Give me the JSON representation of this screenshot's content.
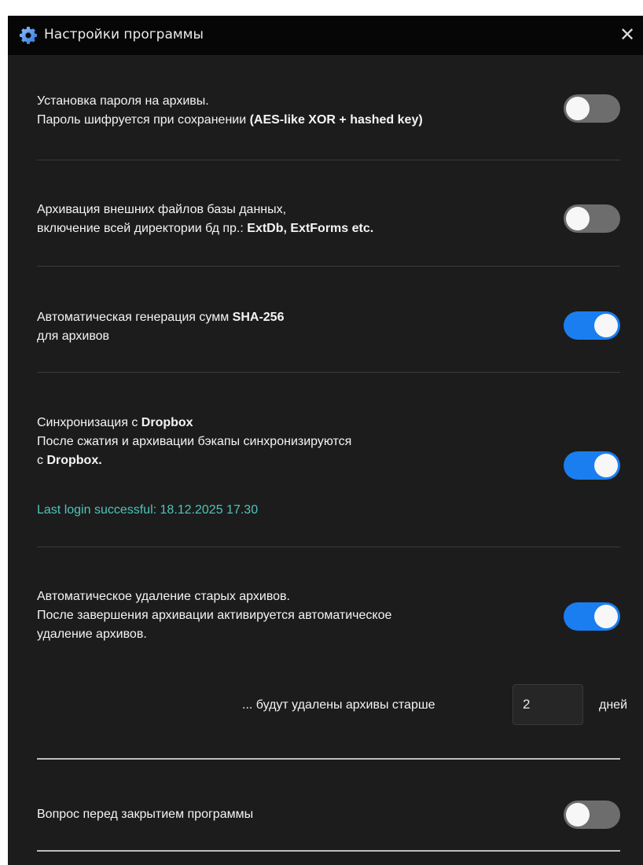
{
  "window": {
    "title": "Настройки программы",
    "close_symbol": "✕",
    "icon": "gear-icon"
  },
  "settings": [
    {
      "id": "archive-password",
      "line1_plain": "Установка пароля на архивы.",
      "line2_plain": "Пароль шифруется при сохранении ",
      "line2_bold": "(AES-like XOR + hashed key)",
      "enabled": false
    },
    {
      "id": "external-files",
      "line1_plain": "Архивация внешних файлов базы данных,",
      "line2_plain": "включение всей директории бд пр.: ",
      "line2_bold": "ExtDb, ExtForms etc.",
      "enabled": false
    },
    {
      "id": "sha256",
      "line1_plain": "Автоматическая генерация сумм ",
      "line1_bold": "SHA-256",
      "line2_plain": "для архивов",
      "enabled": true
    },
    {
      "id": "dropbox",
      "line1_plain": "Синхронизация с ",
      "line1_bold": "Dropbox",
      "line2_plain": "После сжатия и архивации бэкапы синхронизируются",
      "line3_plain": "с ",
      "line3_bold": "Dropbox.",
      "status": "Last login successful: 18.12.2025 17.30",
      "enabled": true
    },
    {
      "id": "auto-delete",
      "line1_plain": "Автоматическое удаление старых архивов.",
      "line2_plain": "После завершения архивации активируется автоматическое",
      "line3_plain": "удаление архивов.",
      "days_label": "... будут удалены архивы старше",
      "days_value": "2",
      "days_unit": "дней",
      "enabled": true
    },
    {
      "id": "confirm-close",
      "line1_plain": "Вопрос перед закрытием программы",
      "enabled": false
    }
  ],
  "colors": {
    "toggle_on": "#1a7ef0",
    "toggle_off": "#6d6d6d",
    "status": "#4fc4b9",
    "background": "#1c1c1c"
  }
}
